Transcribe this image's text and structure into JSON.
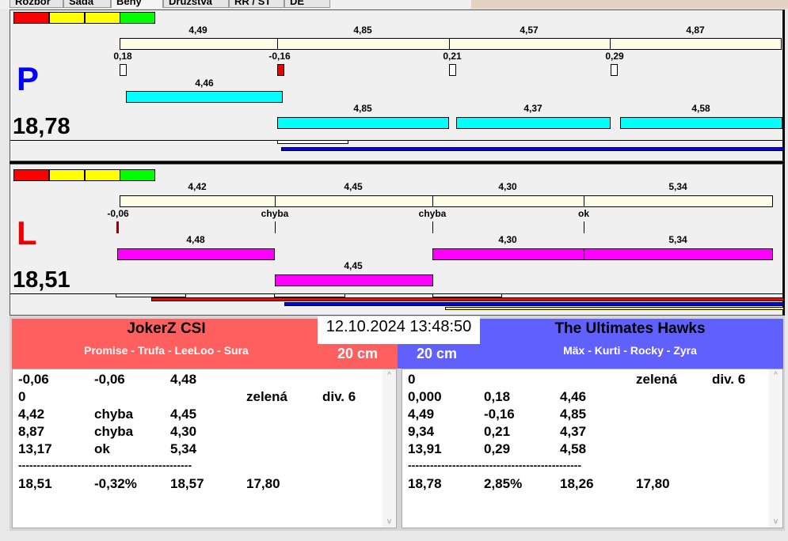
{
  "tabs": [
    "Rozbor",
    "Sada",
    "Běhy",
    "Družstva",
    "RR / ST",
    "DE"
  ],
  "colors": {
    "red": "#ff0000",
    "yellow": "#ffff00",
    "green": "#00ff00",
    "cyan": "#00ffff",
    "magenta": "#ff00ff",
    "team_left": "#ff5f5f",
    "team_right": "#6060ff"
  },
  "panel_p": {
    "letter": "P",
    "total": "18,78",
    "top_values": [
      "4,49",
      "4,85",
      "4,57",
      "4,87"
    ],
    "reaction_values": [
      "0,18",
      "-0,16",
      "0,21",
      "0,29"
    ],
    "bar1_value": "4,46",
    "bar2_values": [
      "4,85",
      "4,37",
      "4,58"
    ]
  },
  "panel_l": {
    "letter": "L",
    "total": "18,51",
    "top_values": [
      "4,42",
      "4,45",
      "4,30",
      "5,34"
    ],
    "reaction_values": [
      "-0,06",
      "chyba",
      "chyba",
      "ok"
    ],
    "bar1_values": [
      "4,48",
      "4,30",
      "5,34"
    ],
    "bar2_value": "4,45"
  },
  "datetime": "12.10.2024 13:48:50",
  "left_team": {
    "name": "JokerZ CSI",
    "members": "Promise - Trufa - LeeLoo - Sura",
    "height": "20 cm",
    "rows": [
      [
        "-0,06",
        "-0,06",
        "4,48",
        "",
        ""
      ],
      [
        "0",
        "",
        "",
        "zelená",
        "div. 6"
      ],
      [
        "4,42",
        "chyba",
        "4,45",
        "",
        ""
      ],
      [
        "8,87",
        "chyba",
        "4,30",
        "",
        ""
      ],
      [
        "13,17",
        "ok",
        "5,34",
        "",
        ""
      ],
      [
        "-----------------------------------------------",
        "",
        "",
        "",
        ""
      ],
      [
        "18,51",
        "-0,32%",
        "18,57",
        "17,80",
        ""
      ]
    ]
  },
  "right_team": {
    "name": "The Ultimates Hawks",
    "members": "Mäx - Kurti - Rocky - Zyra",
    "height": "20 cm",
    "rows": [
      [
        "0",
        "",
        "",
        "zelená",
        "div. 6"
      ],
      [
        "0,000",
        "0,18",
        "4,46",
        "",
        ""
      ],
      [
        "4,49",
        "-0,16",
        "4,85",
        "",
        ""
      ],
      [
        "9,34",
        "0,21",
        "4,37",
        "",
        ""
      ],
      [
        "13,91",
        "0,29",
        "4,58",
        "",
        ""
      ],
      [
        "-----------------------------------------------",
        "",
        "",
        "",
        ""
      ],
      [
        "18,78",
        "2,85%",
        "18,26",
        "17,80",
        ""
      ]
    ]
  }
}
